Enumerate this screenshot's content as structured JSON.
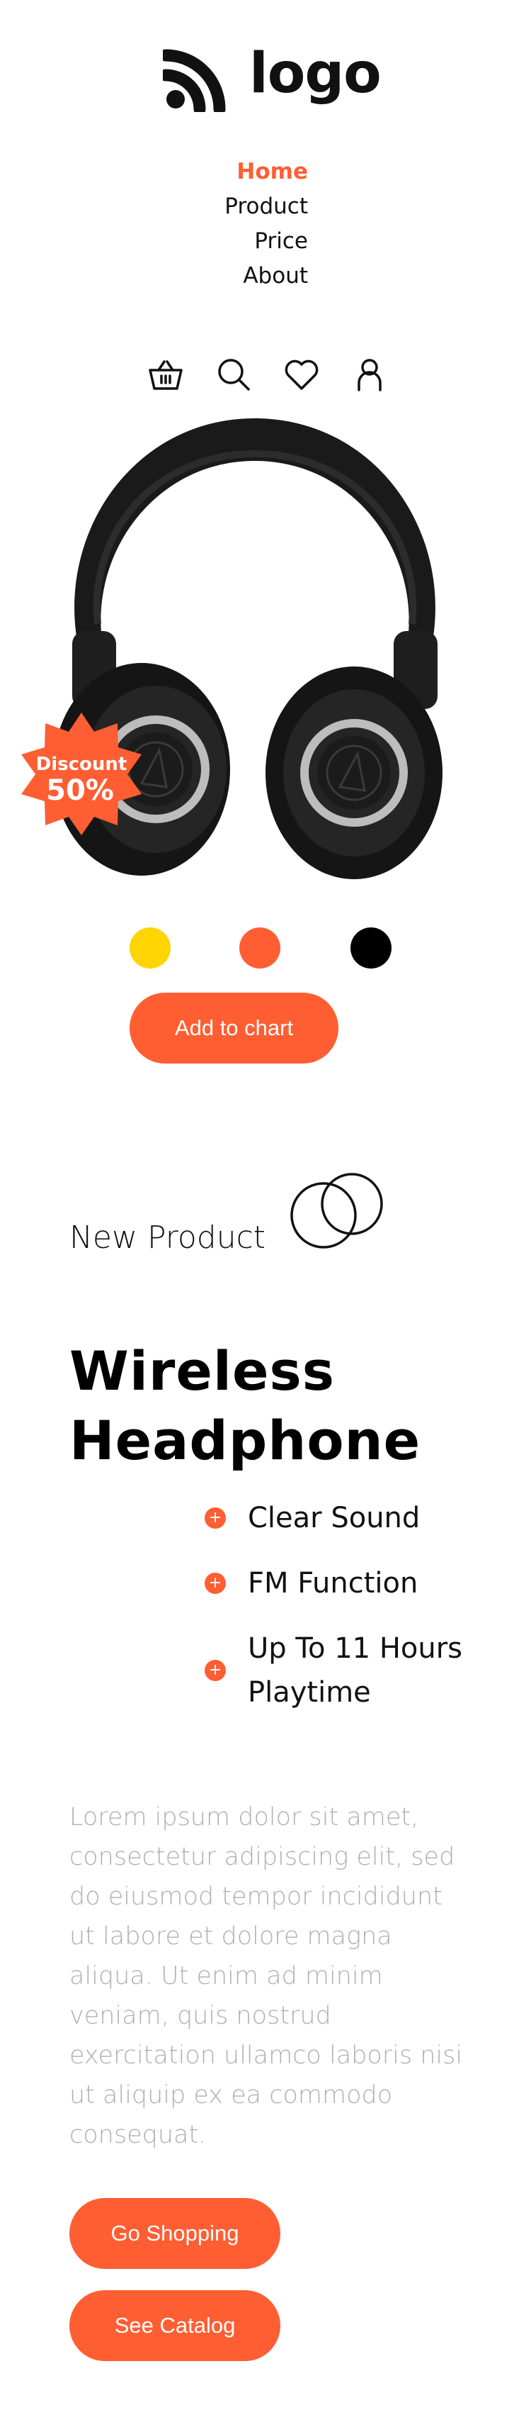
{
  "brand": {
    "logo_text": "logo",
    "logo_icon": "signal-waves-icon"
  },
  "nav": {
    "items": [
      {
        "label": "Home",
        "active": true
      },
      {
        "label": "Product",
        "active": false
      },
      {
        "label": "Price",
        "active": false
      },
      {
        "label": "About",
        "active": false
      }
    ]
  },
  "header_icons": [
    "basket-icon",
    "search-icon",
    "heart-icon",
    "user-icon"
  ],
  "hero": {
    "badge_label": "Discount",
    "badge_value": "50%",
    "color_options": [
      {
        "name": "yellow",
        "hex": "#ffd400"
      },
      {
        "name": "orange",
        "hex": "#ff5e33"
      },
      {
        "name": "black",
        "hex": "#000000"
      }
    ],
    "add_button": "Add to chart"
  },
  "product": {
    "tag": "New Product",
    "title_line1": "Wireless",
    "title_line2": "Headphone",
    "features": [
      "Clear Sound",
      "FM Function",
      "Up To 11 Hours Playtime"
    ],
    "description": "Lorem ipsum dolor sit amet, consectetur adipiscing elit, sed do eiusmod tempor incididunt ut labore et dolore magna aliqua. Ut enim ad minim veniam, quis nostrud exercitation ullamco laboris nisi ut aliquip ex ea commodo consequat.",
    "primary_button": "Go Shopping",
    "secondary_button": "See Catalog"
  },
  "colors": {
    "accent": "#ff5e33",
    "text": "#111111",
    "muted": "#b0b0b0"
  }
}
